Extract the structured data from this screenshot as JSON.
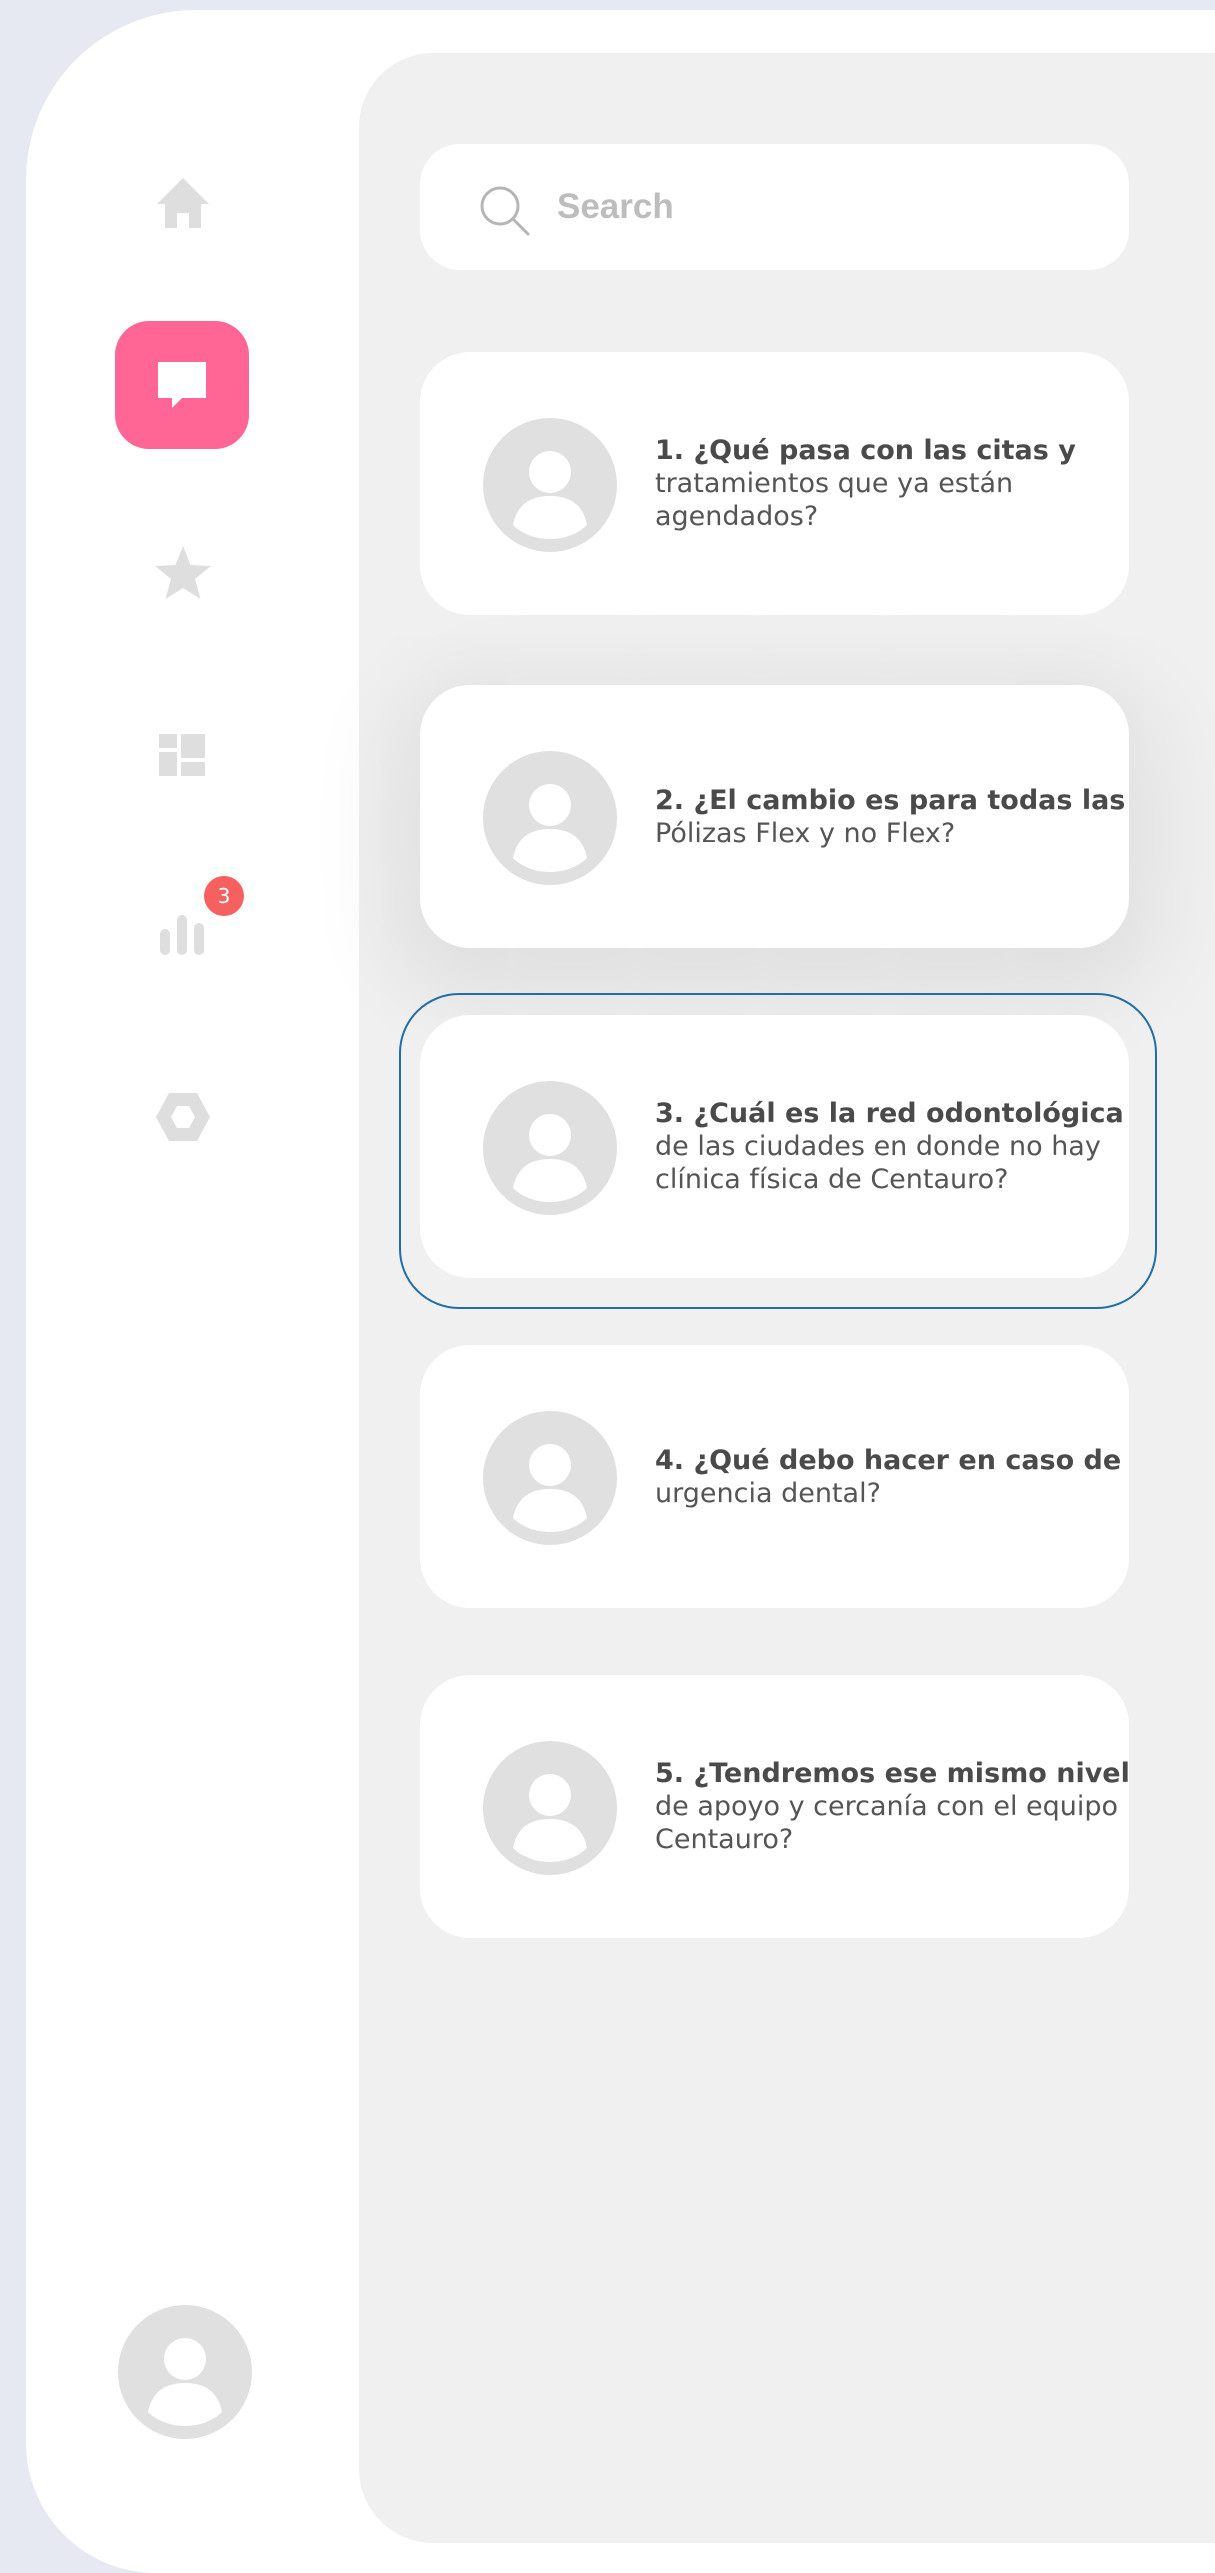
{
  "colors": {
    "background": "#e6e9f1",
    "window": "#ffffff",
    "panel": "#f0f0f0",
    "accent": "#ff6696",
    "badge": "#f5615f",
    "focus": "#1f6ea8",
    "icon": "#dedede"
  },
  "sidebar": {
    "items": [
      {
        "name": "home",
        "icon": "home-icon",
        "active": false
      },
      {
        "name": "messages",
        "icon": "chat-icon",
        "active": true
      },
      {
        "name": "favorites",
        "icon": "star-icon",
        "active": false
      },
      {
        "name": "dashboard",
        "icon": "dashboard-icon",
        "active": false
      },
      {
        "name": "stats",
        "icon": "bar-chart-icon",
        "active": false,
        "badge": "3"
      },
      {
        "name": "settings",
        "icon": "hexagon-icon",
        "active": false
      }
    ],
    "user_avatar": "avatar-icon"
  },
  "search": {
    "placeholder": "Search",
    "icon": "search-icon"
  },
  "faq": [
    {
      "title": "1. ¿Qué pasa con las citas y",
      "body": [
        "tratamientos que ya están",
        "agendados?"
      ]
    },
    {
      "title": "2. ¿El cambio es para todas las",
      "body": [
        "Pólizas Flex y no Flex?"
      ]
    },
    {
      "title": "3. ¿Cuál es la red odontológica",
      "body": [
        "de las ciudades en donde no hay",
        "clínica física de Centauro?"
      ],
      "focused": true
    },
    {
      "title": "4. ¿Qué debo hacer en caso de",
      "body": [
        "urgencia dental?"
      ]
    },
    {
      "title": "5. ¿Tendremos ese mismo nivel",
      "body": [
        "de apoyo y cercanía con el equipo",
        "Centauro?"
      ]
    }
  ]
}
